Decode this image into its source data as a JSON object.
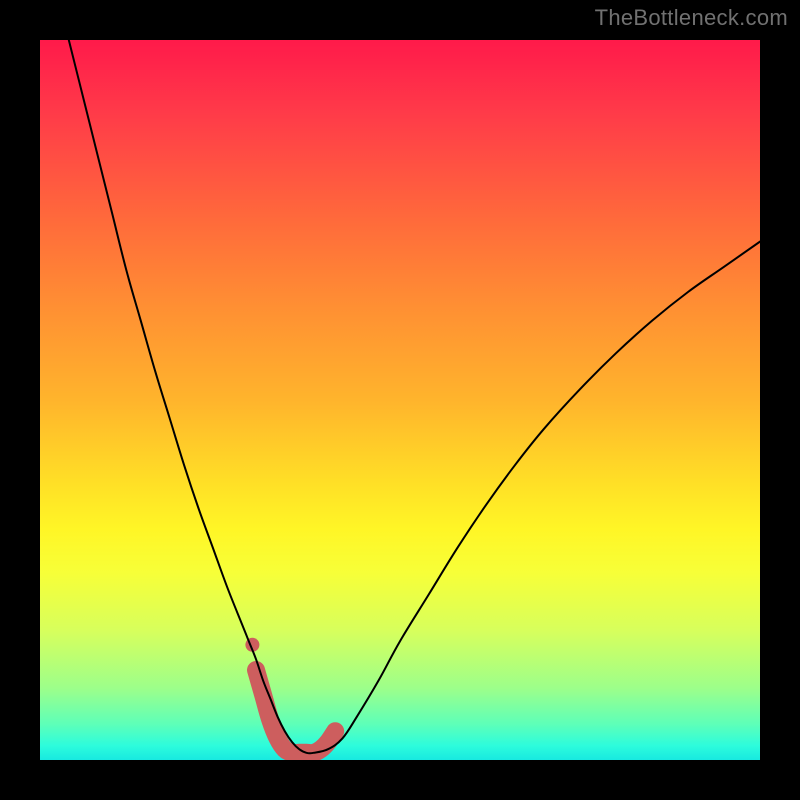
{
  "watermark": "TheBottleneck.com",
  "chart_data": {
    "type": "line",
    "title": "",
    "xlabel": "",
    "ylabel": "",
    "xlim": [
      0,
      100
    ],
    "ylim": [
      0,
      100
    ],
    "grid": false,
    "legend": false,
    "series": [
      {
        "name": "curve",
        "x_pct": [
          4,
          6,
          8,
          10,
          12,
          14,
          16,
          18,
          20,
          22,
          24,
          26,
          28,
          29,
          30,
          31,
          32,
          33,
          34,
          35,
          36,
          37,
          38,
          40,
          42,
          44,
          47,
          50,
          54,
          58,
          62,
          66,
          70,
          75,
          80,
          85,
          90,
          95,
          100
        ],
        "y_pct": [
          100,
          92,
          84,
          76,
          68,
          61,
          54,
          47.5,
          41,
          35,
          29.5,
          24,
          19,
          16.5,
          14,
          11,
          8.5,
          6,
          4,
          2.5,
          1.5,
          1,
          1,
          1.5,
          3,
          6,
          11,
          16.5,
          23,
          29.5,
          35.5,
          41,
          46,
          51.5,
          56.5,
          61,
          65,
          68.5,
          72
        ],
        "color": "#000000",
        "stroke_width_px": 2
      },
      {
        "name": "bottom-highlight",
        "x_pct": [
          30,
          31,
          32,
          33,
          34,
          35,
          36,
          37,
          38,
          39,
          40,
          41
        ],
        "y_pct": [
          12.5,
          9,
          5.5,
          3,
          1.5,
          1,
          1,
          1,
          1,
          1.5,
          2.5,
          4
        ],
        "color": "#cd5e5e",
        "stroke_width_px": 18
      },
      {
        "name": "highlight-lone-dot",
        "x_pct": [
          29.5
        ],
        "y_pct": [
          16
        ],
        "color": "#cd5e5e",
        "marker_radius_px": 7
      }
    ],
    "background_gradient": [
      {
        "stop": 0.0,
        "color": "#ff1a4a"
      },
      {
        "stop": 0.1,
        "color": "#ff3a49"
      },
      {
        "stop": 0.25,
        "color": "#ff6a3b"
      },
      {
        "stop": 0.37,
        "color": "#ff8f33"
      },
      {
        "stop": 0.5,
        "color": "#ffb42c"
      },
      {
        "stop": 0.62,
        "color": "#ffe126"
      },
      {
        "stop": 0.68,
        "color": "#fff626"
      },
      {
        "stop": 0.74,
        "color": "#f7ff38"
      },
      {
        "stop": 0.82,
        "color": "#d7ff5c"
      },
      {
        "stop": 0.9,
        "color": "#9dff8a"
      },
      {
        "stop": 0.95,
        "color": "#5effb8"
      },
      {
        "stop": 0.98,
        "color": "#2dfcdc"
      },
      {
        "stop": 1.0,
        "color": "#18e9e0"
      }
    ]
  }
}
